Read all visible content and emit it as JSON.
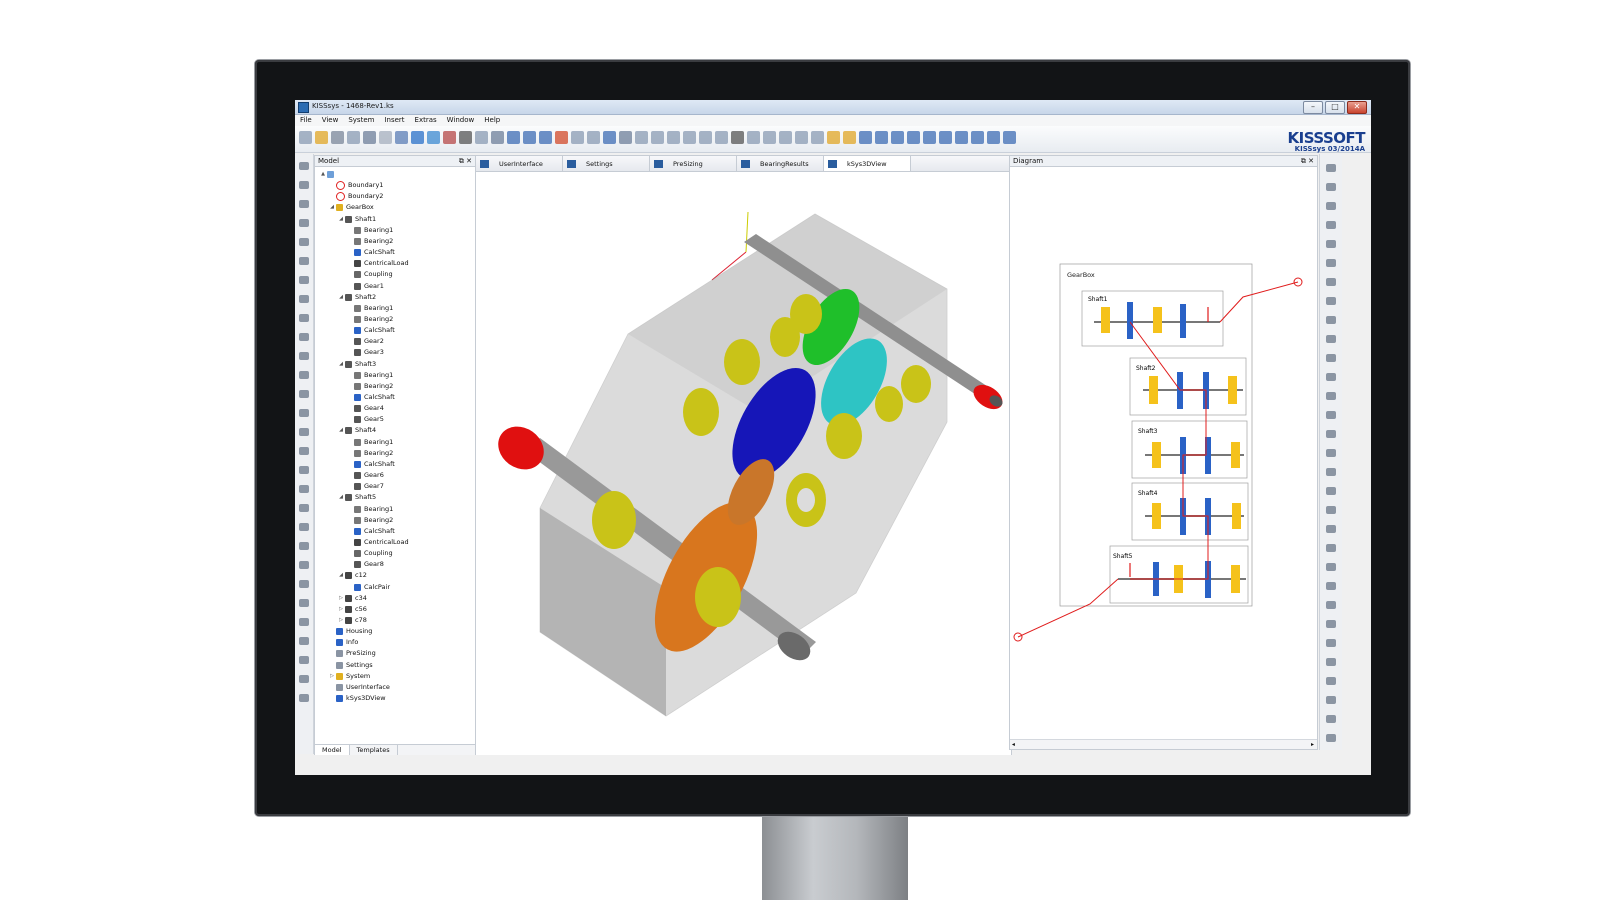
{
  "window": {
    "title": "KISSsys - 1468-Rev1.ks"
  },
  "menu": [
    "File",
    "View",
    "System",
    "Insert",
    "Extras",
    "Window",
    "Help"
  ],
  "logo": {
    "kiss": "KISS",
    "soft": "SOFT",
    "version": "KISSsys 03/2014A"
  },
  "model_panel": {
    "title": "Model",
    "tabs": [
      "Model",
      "Templates"
    ],
    "tree": [
      {
        "label": "",
        "level": 0,
        "icon": "folder",
        "twisty": "▲"
      },
      {
        "label": "Boundary1",
        "level": 1,
        "icon": "boundary",
        "twisty": ""
      },
      {
        "label": "Boundary2",
        "level": 1,
        "icon": "boundary",
        "twisty": ""
      },
      {
        "label": "GearBox",
        "level": 1,
        "icon": "gearbox",
        "twisty": "◢"
      },
      {
        "label": "Shaft1",
        "level": 2,
        "icon": "shaft",
        "twisty": "◢"
      },
      {
        "label": "Bearing1",
        "level": 3,
        "icon": "bearing",
        "twisty": ""
      },
      {
        "label": "Bearing2",
        "level": 3,
        "icon": "bearing",
        "twisty": ""
      },
      {
        "label": "CalcShaft",
        "level": 3,
        "icon": "calc",
        "twisty": ""
      },
      {
        "label": "CentricalLoad",
        "level": 3,
        "icon": "load",
        "twisty": ""
      },
      {
        "label": "Coupling",
        "level": 3,
        "icon": "coupling",
        "twisty": ""
      },
      {
        "label": "Gear1",
        "level": 3,
        "icon": "gear",
        "twisty": ""
      },
      {
        "label": "Shaft2",
        "level": 2,
        "icon": "shaft",
        "twisty": "◢"
      },
      {
        "label": "Bearing1",
        "level": 3,
        "icon": "bearing",
        "twisty": ""
      },
      {
        "label": "Bearing2",
        "level": 3,
        "icon": "bearing",
        "twisty": ""
      },
      {
        "label": "CalcShaft",
        "level": 3,
        "icon": "calc",
        "twisty": ""
      },
      {
        "label": "Gear2",
        "level": 3,
        "icon": "gear",
        "twisty": ""
      },
      {
        "label": "Gear3",
        "level": 3,
        "icon": "gear",
        "twisty": ""
      },
      {
        "label": "Shaft3",
        "level": 2,
        "icon": "shaft",
        "twisty": "◢"
      },
      {
        "label": "Bearing1",
        "level": 3,
        "icon": "bearing",
        "twisty": ""
      },
      {
        "label": "Bearing2",
        "level": 3,
        "icon": "bearing",
        "twisty": ""
      },
      {
        "label": "CalcShaft",
        "level": 3,
        "icon": "calc",
        "twisty": ""
      },
      {
        "label": "Gear4",
        "level": 3,
        "icon": "gear",
        "twisty": ""
      },
      {
        "label": "Gear5",
        "level": 3,
        "icon": "gear",
        "twisty": ""
      },
      {
        "label": "Shaft4",
        "level": 2,
        "icon": "shaft",
        "twisty": "◢"
      },
      {
        "label": "Bearing1",
        "level": 3,
        "icon": "bearing",
        "twisty": ""
      },
      {
        "label": "Bearing2",
        "level": 3,
        "icon": "bearing",
        "twisty": ""
      },
      {
        "label": "CalcShaft",
        "level": 3,
        "icon": "calc",
        "twisty": ""
      },
      {
        "label": "Gear6",
        "level": 3,
        "icon": "gear",
        "twisty": ""
      },
      {
        "label": "Gear7",
        "level": 3,
        "icon": "gear",
        "twisty": ""
      },
      {
        "label": "Shaft5",
        "level": 2,
        "icon": "shaft",
        "twisty": "◢"
      },
      {
        "label": "Bearing1",
        "level": 3,
        "icon": "bearing",
        "twisty": ""
      },
      {
        "label": "Bearing2",
        "level": 3,
        "icon": "bearing",
        "twisty": ""
      },
      {
        "label": "CalcShaft",
        "level": 3,
        "icon": "calc",
        "twisty": ""
      },
      {
        "label": "CentricalLoad",
        "level": 3,
        "icon": "load",
        "twisty": ""
      },
      {
        "label": "Coupling",
        "level": 3,
        "icon": "coupling",
        "twisty": ""
      },
      {
        "label": "Gear8",
        "level": 3,
        "icon": "gear",
        "twisty": ""
      },
      {
        "label": "c12",
        "level": 2,
        "icon": "pair",
        "twisty": "◢"
      },
      {
        "label": "CalcPair",
        "level": 3,
        "icon": "calcpair",
        "twisty": ""
      },
      {
        "label": "c34",
        "level": 2,
        "icon": "pair",
        "twisty": "▷"
      },
      {
        "label": "c56",
        "level": 2,
        "icon": "pair",
        "twisty": "▷"
      },
      {
        "label": "c78",
        "level": 2,
        "icon": "pair",
        "twisty": "▷"
      },
      {
        "label": "Housing",
        "level": 1,
        "icon": "housing",
        "twisty": ""
      },
      {
        "label": "Info",
        "level": 1,
        "icon": "info",
        "twisty": ""
      },
      {
        "label": "PreSizing",
        "level": 1,
        "icon": "table",
        "twisty": ""
      },
      {
        "label": "Settings",
        "level": 1,
        "icon": "table",
        "twisty": ""
      },
      {
        "label": "System",
        "level": 1,
        "icon": "system",
        "twisty": "▷"
      },
      {
        "label": "UserInterface",
        "level": 1,
        "icon": "table",
        "twisty": ""
      },
      {
        "label": "kSys3DView",
        "level": 1,
        "icon": "view3d",
        "twisty": ""
      }
    ]
  },
  "center_tabs": [
    {
      "label": "UserInterface",
      "active": false
    },
    {
      "label": "Settings",
      "active": false
    },
    {
      "label": "PreSizing",
      "active": false
    },
    {
      "label": "BearingResults",
      "active": false
    },
    {
      "label": "kSys3DView",
      "active": true
    }
  ],
  "diagram": {
    "title": "Diagram",
    "group_label": "GearBox",
    "shafts": [
      "Shaft1",
      "Shaft2",
      "Shaft3",
      "Shaft4",
      "Shaft5"
    ]
  },
  "colors": {
    "gear_green": "#1fbf2a",
    "gear_blue": "#1616b8",
    "gear_cyan": "#2ec4c4",
    "gear_orange": "#d8761e",
    "bearing_yellow": "#c9c318",
    "coupling_red": "#e01010",
    "housing_gray": "#a9a9a9",
    "diagram_line": "#e01c1c",
    "diagram_blue": "#2a62c6",
    "diagram_yellow": "#f5c21b"
  }
}
